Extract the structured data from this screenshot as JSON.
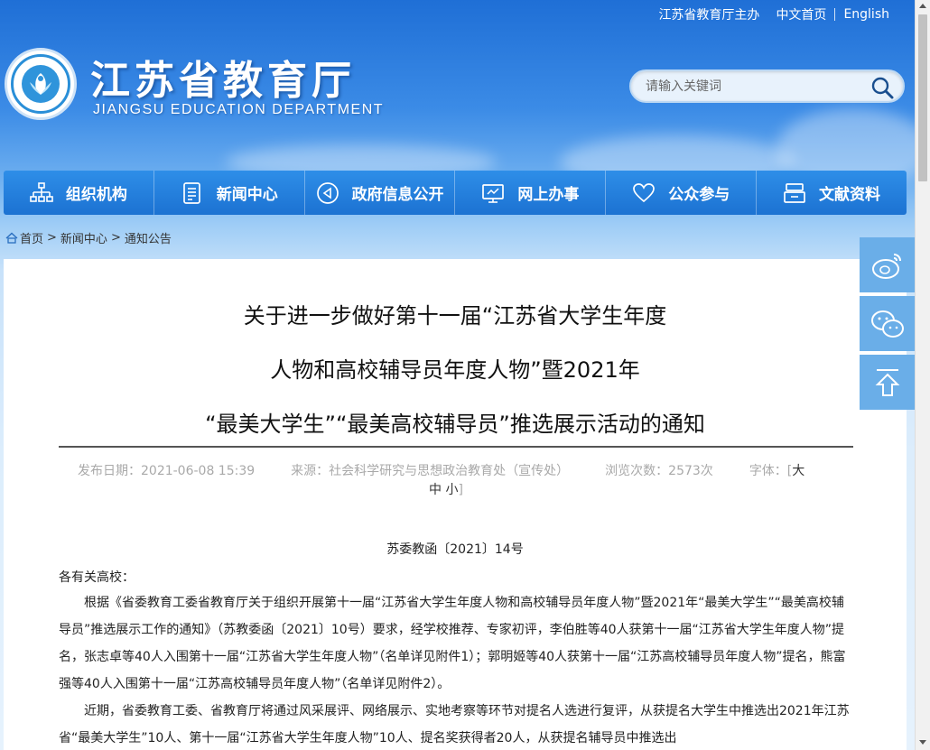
{
  "topbar": {
    "host": "江苏省教育厅主办",
    "chinese": "中文首页",
    "english": "English"
  },
  "logo": {
    "title": "江苏省教育厅",
    "subtitle": "JIANGSU EDUCATION DEPARTMENT"
  },
  "search": {
    "placeholder": "请输入关键词"
  },
  "nav": [
    {
      "label": "组织机构",
      "icon": "org-chart-icon"
    },
    {
      "label": "新闻中心",
      "icon": "document-icon"
    },
    {
      "label": "政府信息公开",
      "icon": "announcement-icon"
    },
    {
      "label": "网上办事",
      "icon": "monitor-icon"
    },
    {
      "label": "公众参与",
      "icon": "heart-icon"
    },
    {
      "label": "文献资料",
      "icon": "archive-icon"
    }
  ],
  "breadcrumb": {
    "home": "首页",
    "sep": ">",
    "news": "新闻中心",
    "notice": "通知公告"
  },
  "article": {
    "title_lines": [
      "关于进一步做好第十一届“江苏省大学生年度",
      "人物和高校辅导员年度人物”暨2021年",
      "“最美大学生”“最美高校辅导员”推选展示活动的通知"
    ],
    "meta": {
      "date": "发布日期：2021-06-08 15:39",
      "source": "来源：社会科学研究与思想政治教育处（宣传处）",
      "views": "浏览次数：2573次",
      "font_label": "字体：[",
      "font_large": "大",
      "font_medium": "中",
      "font_small": "小",
      "font_end": "]"
    },
    "doc_no": "苏委教函〔2021〕14号",
    "salutation": "各有关高校：",
    "para1": "根据《省委教育工委省教育厅关于组织开展第十一届“江苏省大学生年度人物和高校辅导员年度人物”暨2021年“最美大学生”“最美高校辅导员”推选展示工作的通知》（苏教委函〔2021〕10号）要求，经学校推荐、专家初评，李伯胜等40人获第十一届“江苏省大学生年度人物”提名，张志卓等40人入围第十一届“江苏省大学生年度人物”（名单详见附件1）；郭明姬等40人获第十一届“江苏高校辅导员年度人物”提名，熊富强等40人入围第十一届“江苏高校辅导员年度人物”（名单详见附件2）。",
    "para2": "近期，省委教育工委、省教育厅将通过风采展评、网络展示、实地考察等环节对提名人选进行复评，从获提名大学生中推选出2021年江苏省“最美大学生”10人、第十一届“江苏省大学生年度人物”10人、提名奖获得者20人，从获提名辅导员中推选出"
  },
  "side": {
    "weibo_icon": "weibo-icon",
    "wechat_icon": "wechat-icon",
    "top_icon": "back-to-top-icon"
  },
  "colors": {
    "nav_bg": "#1c72d2",
    "side_bg": "#6aaee8",
    "header_bg": "#1f6fd6"
  }
}
